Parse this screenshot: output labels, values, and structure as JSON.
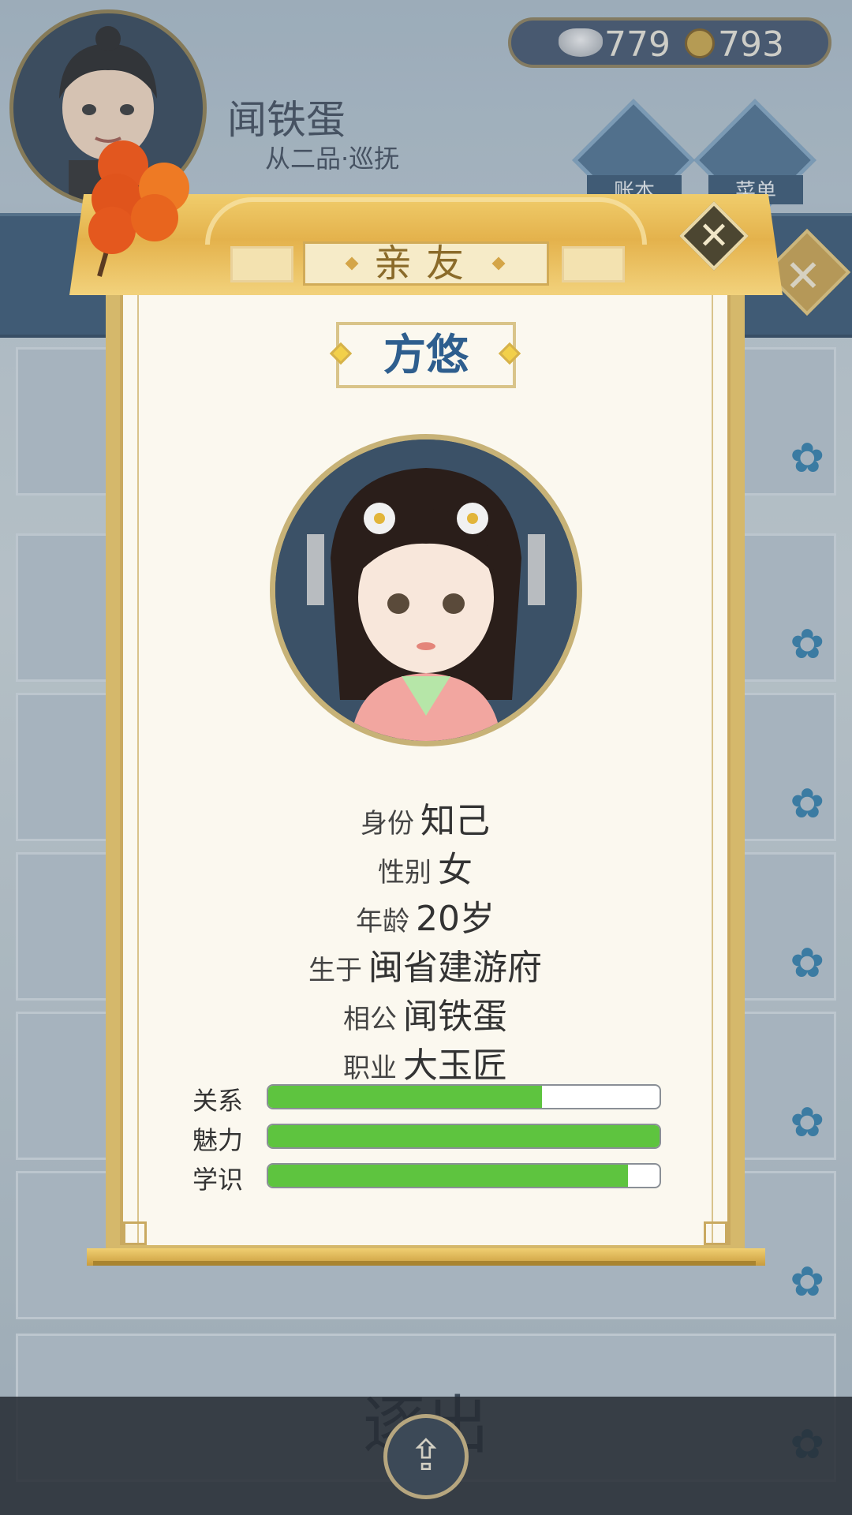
{
  "player": {
    "name": "闻铁蛋",
    "rank": "从二品·巡抚"
  },
  "currency": {
    "silver": "779",
    "coins": "793"
  },
  "top_menu": {
    "ledger_label": "账本",
    "menu_label": "菜单"
  },
  "background": {
    "expel_label": "逐出"
  },
  "dialog": {
    "title": "亲友",
    "character_name": "方悠",
    "info": [
      {
        "label": "身份",
        "value": "知己"
      },
      {
        "label": "性别",
        "value": "女"
      },
      {
        "label": "年龄",
        "value": "20岁"
      },
      {
        "label": "生于",
        "value": "闽省建游府"
      },
      {
        "label": "相公",
        "value": "闻铁蛋"
      },
      {
        "label": "职业",
        "value": "大玉匠"
      }
    ],
    "stats": [
      {
        "label": "关系",
        "fraction": 0.7
      },
      {
        "label": "魅力",
        "fraction": 1.0
      },
      {
        "label": "学识",
        "fraction": 0.92
      }
    ]
  },
  "colors": {
    "stat_fill": "#5ec43f",
    "name_color": "#2e5e8e",
    "panel_gold": "#e4b24c"
  }
}
